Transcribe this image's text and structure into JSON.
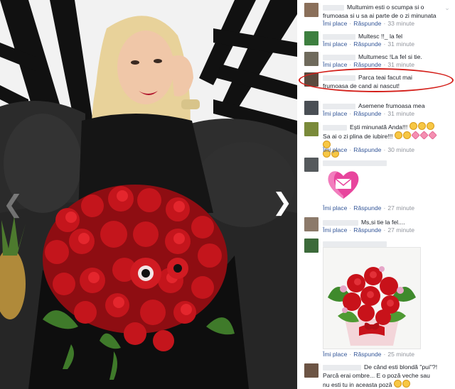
{
  "photo": {
    "next_arrow": "❯",
    "prev_arrow": "❮"
  },
  "comments": {
    "like_label": "Îmi place",
    "reply_label": "Răspunde",
    "separator": "·",
    "items": [
      {
        "text": "Multumim esti o scumpa si o frumoasa si u sa ai parte de o zi minunata",
        "time": "33 minute"
      },
      {
        "text": "Multesc !!_ la fel",
        "time": "31 minute"
      },
      {
        "text": "Multumesc !La fel si tie.",
        "time": "31 minute"
      },
      {
        "text": "Parca teai facut mai frumoasa de cand ai nascut!",
        "time": ""
      },
      {
        "text": "Asemene frumoasa mea",
        "time": "31 minute"
      },
      {
        "text": "Ești minunată Anda!!!",
        "text2": "Sa ai o zi plina de iubire!!!",
        "time": "30 minute"
      },
      {
        "text": "",
        "time": "27 minute"
      },
      {
        "text": "Ms,si tie la fel....",
        "time": "27 minute"
      },
      {
        "text": "",
        "time": "25 minute"
      },
      {
        "text": "De când esti blondă \"pui\"?! Parcă erai ombre... E o poză veche sau nu esti tu in aceasta poză",
        "time": ""
      }
    ]
  },
  "colors": {
    "link": "#365899",
    "meta": "#90949c",
    "text": "#1d2129",
    "highlight_oval": "#d4201b"
  }
}
